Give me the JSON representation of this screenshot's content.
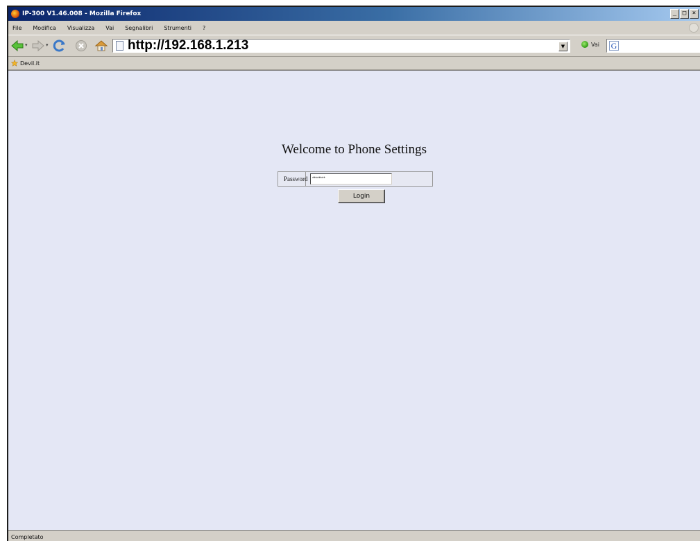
{
  "window": {
    "title": "IP-300 V1.46.008 - Mozilla Firefox",
    "buttons": {
      "minimize": "_",
      "maximize": "□",
      "close": "×"
    }
  },
  "menu": {
    "items": [
      "File",
      "Modifica",
      "Visualizza",
      "Vai",
      "Segnalibri",
      "Strumenti",
      "?"
    ]
  },
  "navigation": {
    "url": "http://192.168.1.213",
    "go_label": "Vai",
    "search_placeholder": "",
    "search_engine_icon": "G"
  },
  "bookmarks": {
    "items": [
      "Devil.it"
    ]
  },
  "page": {
    "heading": "Welcome to Phone Settings",
    "password_label": "Password",
    "password_value": "********",
    "login_button": "Login",
    "background_color": "#e4e7f5"
  },
  "status": {
    "text": "Completato"
  },
  "icons": [
    "firefox-icon",
    "back-icon",
    "forward-icon",
    "reload-icon",
    "stop-icon",
    "home-icon",
    "page-icon",
    "go-icon",
    "google-icon",
    "bookmark-star-icon"
  ]
}
